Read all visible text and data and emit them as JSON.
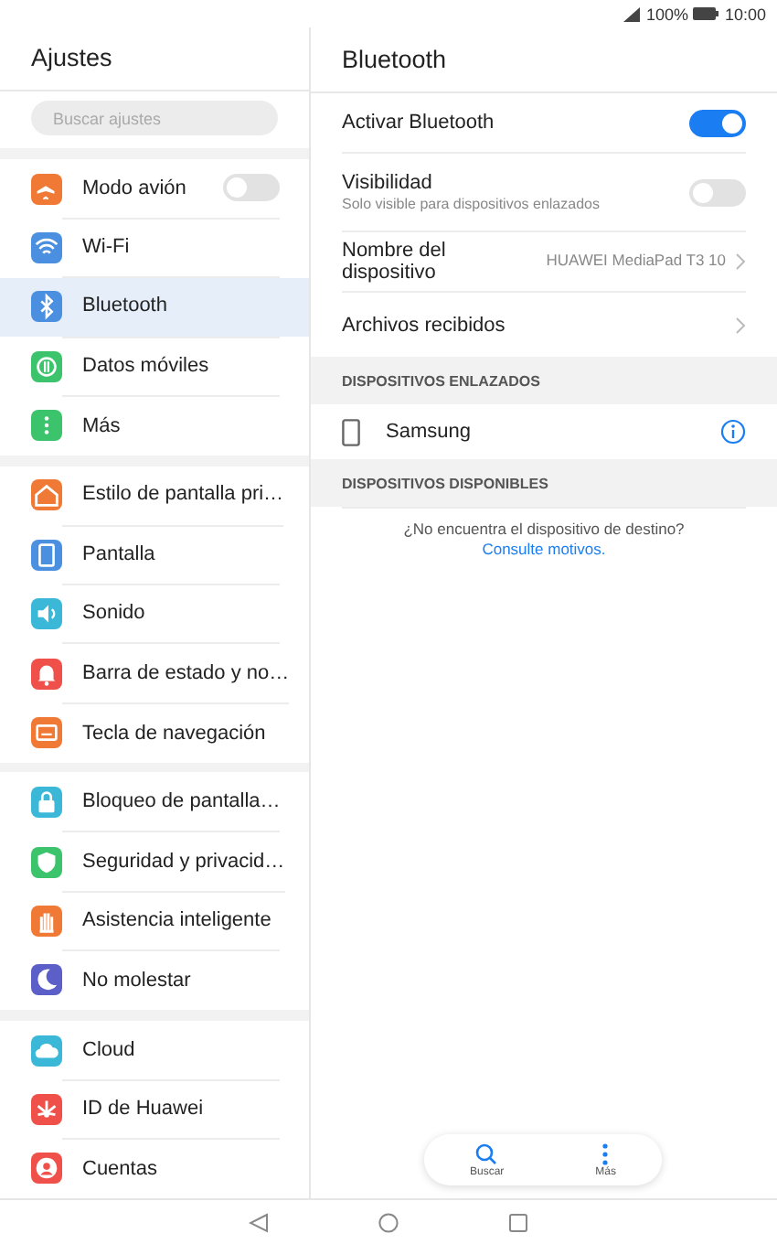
{
  "status_bar": {
    "battery": "100%",
    "time": "10:00"
  },
  "sidebar": {
    "title": "Ajustes",
    "search": {
      "placeholder": "Buscar ajustes"
    },
    "groups": [
      {
        "items": [
          {
            "label": "Modo avión",
            "color": "#f07a35",
            "selected": false,
            "kind": "toggle",
            "on": false
          },
          {
            "label": "Wi-Fi",
            "color": "#4a8fe0",
            "selected": false,
            "kind": "link"
          },
          {
            "label": "Bluetooth",
            "color": "#4a8fe0",
            "selected": true,
            "kind": "link"
          },
          {
            "label": "Datos móviles",
            "color": "#3cc46d",
            "selected": false,
            "kind": "link"
          },
          {
            "label": "Más",
            "color": "#3cc46d",
            "selected": false,
            "kind": "link"
          }
        ]
      },
      {
        "items": [
          {
            "label": "Estilo de pantalla pri…",
            "color": "#f07a35",
            "selected": false,
            "kind": "link"
          },
          {
            "label": "Pantalla",
            "color": "#4a8fe0",
            "selected": false,
            "kind": "link"
          },
          {
            "label": "Sonido",
            "color": "#3bb8d8",
            "selected": false,
            "kind": "link"
          },
          {
            "label": "Barra de estado y no…",
            "color": "#f0504a",
            "selected": false,
            "kind": "link"
          },
          {
            "label": "Tecla de navegación",
            "color": "#f07a35",
            "selected": false,
            "kind": "link"
          }
        ]
      },
      {
        "items": [
          {
            "label": "Bloqueo de pantalla…",
            "color": "#3bb8d8",
            "selected": false,
            "kind": "link"
          },
          {
            "label": "Seguridad y privacid…",
            "color": "#3cc46d",
            "selected": false,
            "kind": "link"
          },
          {
            "label": "Asistencia inteligente",
            "color": "#f07a35",
            "selected": false,
            "kind": "link"
          },
          {
            "label": "No molestar",
            "color": "#5b5fc7",
            "selected": false,
            "kind": "link"
          }
        ]
      },
      {
        "items": [
          {
            "label": "Cloud",
            "color": "#3bb8d8",
            "selected": false,
            "kind": "link"
          },
          {
            "label": "ID de Huawei",
            "color": "#f0504a",
            "selected": false,
            "kind": "link"
          },
          {
            "label": "Cuentas",
            "color": "#f0504a",
            "selected": false,
            "kind": "link"
          }
        ]
      }
    ]
  },
  "detail": {
    "title": "Bluetooth",
    "settings": [
      {
        "kind": "toggle",
        "label": "Activar Bluetooth",
        "on": true
      },
      {
        "kind": "toggle",
        "label": "Visibilidad",
        "subtitle": "Solo visible para dispositivos enlazados",
        "on": false
      },
      {
        "kind": "value",
        "label": "Nombre del dispositivo",
        "value": "HUAWEI MediaPad T3 10"
      },
      {
        "kind": "link",
        "label": "Archivos recibidos"
      }
    ],
    "paired_header": "DISPOSITIVOS ENLAZADOS",
    "paired": [
      {
        "name": "Samsung"
      }
    ],
    "available_header": "DISPOSITIVOS DISPONIBLES",
    "hint": "¿No encuentra el dispositivo de destino?",
    "hint_link": "Consulte motivos."
  },
  "bottom_actions": [
    {
      "kind": "search",
      "label": "Buscar"
    },
    {
      "kind": "more",
      "label": "Más"
    }
  ]
}
